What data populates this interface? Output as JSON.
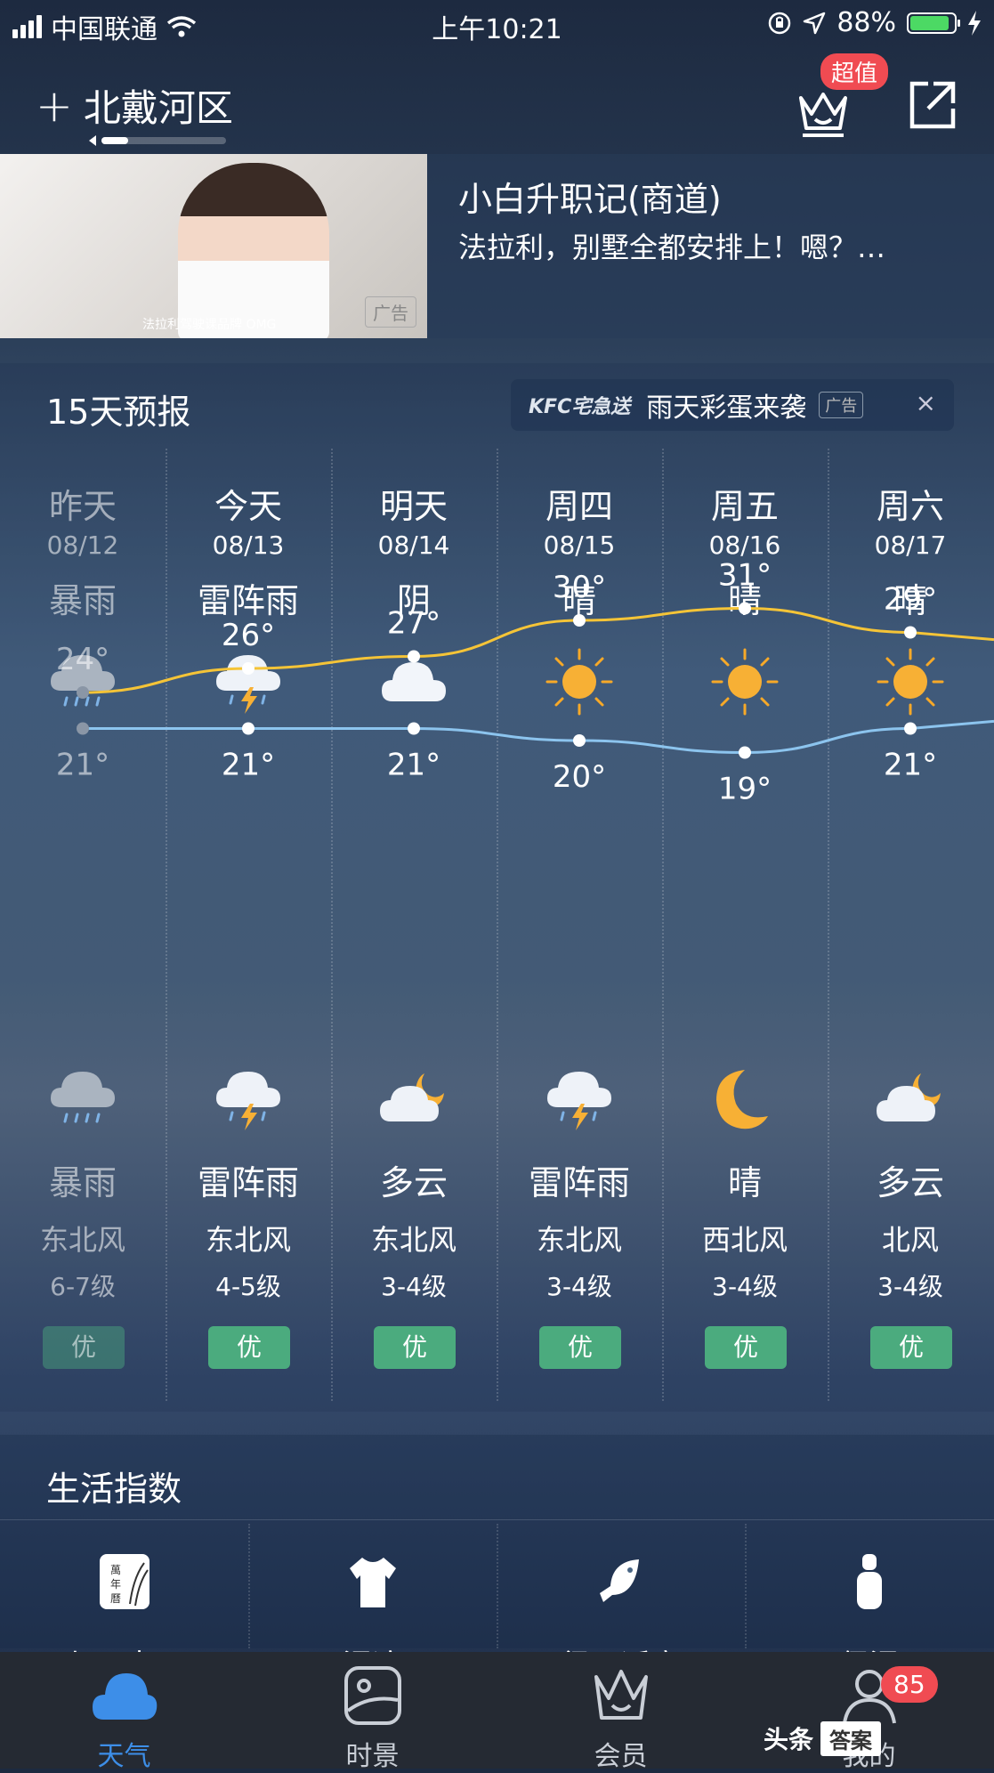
{
  "status_bar": {
    "carrier": "中国联通",
    "time": "上午10:21",
    "battery": "88%",
    "battery_level": 0.88
  },
  "header": {
    "city": "北戴河区",
    "vip_badge": "超值"
  },
  "ad_banner": {
    "title": "小白升职记(商道)",
    "description": "法拉利，别墅全都安排上！嗯？…",
    "caption": "法拉利驾驶课品牌 OMG",
    "ad_tag": "广告"
  },
  "forecast": {
    "title": "15天预报",
    "kfc_ad": {
      "brand": "KFC宅急送",
      "text": "雨天彩蛋来袭",
      "tag": "广告",
      "close": "×"
    },
    "days": [
      {
        "name": "昨天",
        "date": "08/12",
        "day_weather": "暴雨",
        "day_icon": "heavy-rain-icon",
        "high": "24°",
        "low": "21°",
        "night_icon": "heavy-rain-icon",
        "night_weather": "暴雨",
        "wind": "东北风",
        "wind_level": "6-7级",
        "aqi": "优"
      },
      {
        "name": "今天",
        "date": "08/13",
        "day_weather": "雷阵雨",
        "day_icon": "thunderstorm-icon",
        "high": "26°",
        "low": "21°",
        "night_icon": "thunderstorm-icon",
        "night_weather": "雷阵雨",
        "wind": "东北风",
        "wind_level": "4-5级",
        "aqi": "优"
      },
      {
        "name": "明天",
        "date": "08/14",
        "day_weather": "阴",
        "day_icon": "cloudy-icon",
        "high": "27°",
        "low": "21°",
        "night_icon": "cloudy-night-icon",
        "night_weather": "多云",
        "wind": "东北风",
        "wind_level": "3-4级",
        "aqi": "优"
      },
      {
        "name": "周四",
        "date": "08/15",
        "day_weather": "晴",
        "day_icon": "sun-icon",
        "high": "30°",
        "low": "20°",
        "night_icon": "thunderstorm-icon",
        "night_weather": "雷阵雨",
        "wind": "东北风",
        "wind_level": "3-4级",
        "aqi": "优"
      },
      {
        "name": "周五",
        "date": "08/16",
        "day_weather": "晴",
        "day_icon": "sun-icon",
        "high": "31°",
        "low": "19°",
        "night_icon": "moon-icon",
        "night_weather": "晴",
        "wind": "西北风",
        "wind_level": "3-4级",
        "aqi": "优"
      },
      {
        "name": "周六",
        "date": "08/17",
        "day_weather": "晴",
        "day_icon": "sun-icon",
        "high": "29°",
        "low": "21°",
        "night_icon": "cloudy-night-icon",
        "night_weather": "多云",
        "wind": "北风",
        "wind_level": "3-4级",
        "aqi": "优"
      }
    ],
    "high_temps": [
      24,
      26,
      27,
      30,
      31,
      29
    ],
    "low_temps": [
      21,
      21,
      21,
      20,
      19,
      21
    ],
    "high_line_color": "#f5c437",
    "low_line_color": "#8cc4ee"
  },
  "life_index": {
    "title": "生活指数",
    "items": [
      {
        "label": "七月十三",
        "icon": "almanac-icon"
      },
      {
        "label": "湿凉",
        "icon": "tshirt-icon"
      },
      {
        "label": "很不适宜",
        "icon": "fish-icon"
      },
      {
        "label": "保湿",
        "icon": "lotion-icon"
      }
    ]
  },
  "tabbar": {
    "tabs": [
      {
        "label": "天气",
        "icon": "cloud-icon",
        "active": true
      },
      {
        "label": "时景",
        "icon": "scenery-icon",
        "active": false
      },
      {
        "label": "会员",
        "icon": "crown-icon",
        "active": false
      },
      {
        "label": "我的",
        "icon": "profile-icon",
        "active": false
      }
    ],
    "profile_badge": "85"
  },
  "watermark": {
    "text": "头条",
    "box": "答案"
  }
}
